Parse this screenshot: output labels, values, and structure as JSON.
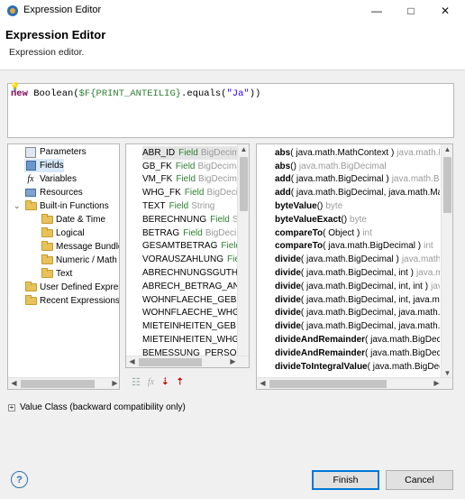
{
  "window": {
    "title": "Expression Editor",
    "minimize_icon": "minimize-icon",
    "maximize_icon": "maximize-icon",
    "close_icon": "close-icon"
  },
  "header": {
    "title": "Expression Editor",
    "description": "Expression editor."
  },
  "editor": {
    "code_parts": [
      "new",
      " Boolean(",
      "$F{PRINT_ANTEILIG}",
      ".equals(",
      "\"Ja\"",
      "))"
    ]
  },
  "tree": {
    "items": [
      {
        "label": "Parameters",
        "icon": "parameters-icon"
      },
      {
        "label": "Fields",
        "icon": "fields-icon"
      },
      {
        "label": "Variables",
        "icon": "variables-icon",
        "glyph": "fx"
      },
      {
        "label": "Resources",
        "icon": "resources-icon"
      },
      {
        "label": "Built-in Functions",
        "icon": "folder-icon",
        "toggle": "⌄"
      },
      {
        "label": "Date & Time",
        "icon": "folder-icon"
      },
      {
        "label": "Logical",
        "icon": "folder-icon"
      },
      {
        "label": "Message Bundle",
        "icon": "folder-icon"
      },
      {
        "label": "Numeric / Math",
        "icon": "folder-icon"
      },
      {
        "label": "Text",
        "icon": "folder-icon"
      },
      {
        "label": "User Defined Expres",
        "icon": "folder-icon"
      },
      {
        "label": "Recent Expressions",
        "icon": "folder-icon"
      }
    ]
  },
  "fields_list": {
    "items": [
      {
        "name": "ABR_ID",
        "type": "Field",
        "cls": "BigDecima"
      },
      {
        "name": "GB_FK",
        "type": "Field",
        "cls": "BigDecimal"
      },
      {
        "name": "VM_FK",
        "type": "Field",
        "cls": "BigDecim"
      },
      {
        "name": "WHG_FK",
        "type": "Field",
        "cls": "BigDecim"
      },
      {
        "name": "TEXT",
        "type": "Field",
        "cls": "String"
      },
      {
        "name": "BERECHNUNG",
        "type": "Field",
        "cls": "Str"
      },
      {
        "name": "BETRAG",
        "type": "Field",
        "cls": "BigDecima"
      },
      {
        "name": "GESAMTBETRAG",
        "type": "Field",
        "cls": "E"
      },
      {
        "name": "VORAUSZAHLUNG",
        "type": "Fiel",
        "cls": ""
      },
      {
        "name": "ABRECHNUNGSGUTHA",
        "type": "",
        "cls": ""
      },
      {
        "name": "ABRECH_BETRAG_ANTE",
        "type": "",
        "cls": ""
      },
      {
        "name": "WOHNFLAECHE_GEB",
        "type": "F",
        "cls": ""
      },
      {
        "name": "WOHNFLAECHE_WHG",
        "type": "",
        "cls": ""
      },
      {
        "name": "MIETEINHEITEN_GEB",
        "type": "Fi",
        "cls": ""
      },
      {
        "name": "MIETEINHEITEN_WHG",
        "type": "F",
        "cls": ""
      },
      {
        "name": "BEMESSUNG_PERSONE",
        "type": "",
        "cls": ""
      }
    ]
  },
  "methods_list": {
    "items": [
      {
        "name": "abs",
        "params": "( java.math.MathContext )",
        "ret": "java.math.B"
      },
      {
        "name": "abs",
        "params": "()",
        "ret": "java.math.BigDecimal"
      },
      {
        "name": "add",
        "params": "( java.math.BigDecimal )",
        "ret": "java.math.Big"
      },
      {
        "name": "add",
        "params": "( java.math.BigDecimal, java.math.Mat",
        "ret": ""
      },
      {
        "name": "byteValue",
        "params": "()",
        "ret": "byte"
      },
      {
        "name": "byteValueExact",
        "params": "()",
        "ret": "byte"
      },
      {
        "name": "compareTo",
        "params": "( Object )",
        "ret": "int"
      },
      {
        "name": "compareTo",
        "params": "( java.math.BigDecimal )",
        "ret": "int"
      },
      {
        "name": "divide",
        "params": "( java.math.BigDecimal )",
        "ret": "java.math.Bi"
      },
      {
        "name": "divide",
        "params": "( java.math.BigDecimal, int )",
        "ret": "java.m"
      },
      {
        "name": "divide",
        "params": "( java.math.BigDecimal, int, int )",
        "ret": "java"
      },
      {
        "name": "divide",
        "params": "( java.math.BigDecimal, int, java.ma",
        "ret": ""
      },
      {
        "name": "divide",
        "params": "( java.math.BigDecimal, java.math.M",
        "ret": ""
      },
      {
        "name": "divide",
        "params": "( java.math.BigDecimal, java.math.R",
        "ret": ""
      },
      {
        "name": "divideAndRemainder",
        "params": "( java.math.BigDeci",
        "ret": ""
      },
      {
        "name": "divideAndRemainder",
        "params": "( java.math.BigDeci",
        "ret": ""
      },
      {
        "name": "divideToIntegralValue",
        "params": "( java.math.BigDec",
        "ret": ""
      }
    ]
  },
  "toolbar": {
    "icons": [
      "add-field-icon",
      "function-icon",
      "sort-descending-icon",
      "sort-ascending-icon"
    ]
  },
  "value_class": {
    "label": "Value Class (backward compatibility only)",
    "toggle": "+"
  },
  "footer": {
    "help_icon": "help-icon",
    "finish_label": "Finish",
    "cancel_label": "Cancel"
  },
  "colors": {
    "keyword": "#7f0055",
    "field": "#2e7d32",
    "string": "#2a00ff",
    "default_button_border": "#0078d7"
  }
}
